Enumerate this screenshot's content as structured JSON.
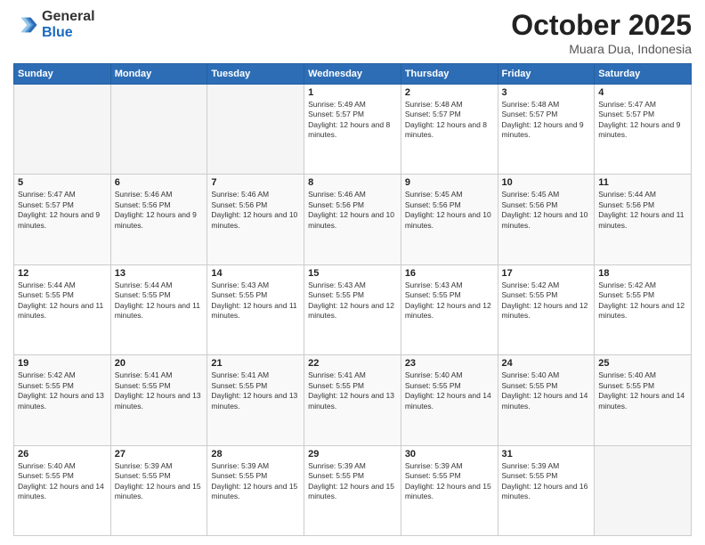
{
  "header": {
    "logo_general": "General",
    "logo_blue": "Blue",
    "month": "October 2025",
    "location": "Muara Dua, Indonesia"
  },
  "weekdays": [
    "Sunday",
    "Monday",
    "Tuesday",
    "Wednesday",
    "Thursday",
    "Friday",
    "Saturday"
  ],
  "weeks": [
    [
      {
        "day": "",
        "empty": true
      },
      {
        "day": "",
        "empty": true
      },
      {
        "day": "",
        "empty": true
      },
      {
        "day": "1",
        "sunrise": "5:49 AM",
        "sunset": "5:57 PM",
        "daylight": "12 hours and 8 minutes."
      },
      {
        "day": "2",
        "sunrise": "5:48 AM",
        "sunset": "5:57 PM",
        "daylight": "12 hours and 8 minutes."
      },
      {
        "day": "3",
        "sunrise": "5:48 AM",
        "sunset": "5:57 PM",
        "daylight": "12 hours and 9 minutes."
      },
      {
        "day": "4",
        "sunrise": "5:47 AM",
        "sunset": "5:57 PM",
        "daylight": "12 hours and 9 minutes."
      }
    ],
    [
      {
        "day": "5",
        "sunrise": "5:47 AM",
        "sunset": "5:57 PM",
        "daylight": "12 hours and 9 minutes."
      },
      {
        "day": "6",
        "sunrise": "5:46 AM",
        "sunset": "5:56 PM",
        "daylight": "12 hours and 9 minutes."
      },
      {
        "day": "7",
        "sunrise": "5:46 AM",
        "sunset": "5:56 PM",
        "daylight": "12 hours and 10 minutes."
      },
      {
        "day": "8",
        "sunrise": "5:46 AM",
        "sunset": "5:56 PM",
        "daylight": "12 hours and 10 minutes."
      },
      {
        "day": "9",
        "sunrise": "5:45 AM",
        "sunset": "5:56 PM",
        "daylight": "12 hours and 10 minutes."
      },
      {
        "day": "10",
        "sunrise": "5:45 AM",
        "sunset": "5:56 PM",
        "daylight": "12 hours and 10 minutes."
      },
      {
        "day": "11",
        "sunrise": "5:44 AM",
        "sunset": "5:56 PM",
        "daylight": "12 hours and 11 minutes."
      }
    ],
    [
      {
        "day": "12",
        "sunrise": "5:44 AM",
        "sunset": "5:55 PM",
        "daylight": "12 hours and 11 minutes."
      },
      {
        "day": "13",
        "sunrise": "5:44 AM",
        "sunset": "5:55 PM",
        "daylight": "12 hours and 11 minutes."
      },
      {
        "day": "14",
        "sunrise": "5:43 AM",
        "sunset": "5:55 PM",
        "daylight": "12 hours and 11 minutes."
      },
      {
        "day": "15",
        "sunrise": "5:43 AM",
        "sunset": "5:55 PM",
        "daylight": "12 hours and 12 minutes."
      },
      {
        "day": "16",
        "sunrise": "5:43 AM",
        "sunset": "5:55 PM",
        "daylight": "12 hours and 12 minutes."
      },
      {
        "day": "17",
        "sunrise": "5:42 AM",
        "sunset": "5:55 PM",
        "daylight": "12 hours and 12 minutes."
      },
      {
        "day": "18",
        "sunrise": "5:42 AM",
        "sunset": "5:55 PM",
        "daylight": "12 hours and 12 minutes."
      }
    ],
    [
      {
        "day": "19",
        "sunrise": "5:42 AM",
        "sunset": "5:55 PM",
        "daylight": "12 hours and 13 minutes."
      },
      {
        "day": "20",
        "sunrise": "5:41 AM",
        "sunset": "5:55 PM",
        "daylight": "12 hours and 13 minutes."
      },
      {
        "day": "21",
        "sunrise": "5:41 AM",
        "sunset": "5:55 PM",
        "daylight": "12 hours and 13 minutes."
      },
      {
        "day": "22",
        "sunrise": "5:41 AM",
        "sunset": "5:55 PM",
        "daylight": "12 hours and 13 minutes."
      },
      {
        "day": "23",
        "sunrise": "5:40 AM",
        "sunset": "5:55 PM",
        "daylight": "12 hours and 14 minutes."
      },
      {
        "day": "24",
        "sunrise": "5:40 AM",
        "sunset": "5:55 PM",
        "daylight": "12 hours and 14 minutes."
      },
      {
        "day": "25",
        "sunrise": "5:40 AM",
        "sunset": "5:55 PM",
        "daylight": "12 hours and 14 minutes."
      }
    ],
    [
      {
        "day": "26",
        "sunrise": "5:40 AM",
        "sunset": "5:55 PM",
        "daylight": "12 hours and 14 minutes."
      },
      {
        "day": "27",
        "sunrise": "5:39 AM",
        "sunset": "5:55 PM",
        "daylight": "12 hours and 15 minutes."
      },
      {
        "day": "28",
        "sunrise": "5:39 AM",
        "sunset": "5:55 PM",
        "daylight": "12 hours and 15 minutes."
      },
      {
        "day": "29",
        "sunrise": "5:39 AM",
        "sunset": "5:55 PM",
        "daylight": "12 hours and 15 minutes."
      },
      {
        "day": "30",
        "sunrise": "5:39 AM",
        "sunset": "5:55 PM",
        "daylight": "12 hours and 15 minutes."
      },
      {
        "day": "31",
        "sunrise": "5:39 AM",
        "sunset": "5:55 PM",
        "daylight": "12 hours and 16 minutes."
      },
      {
        "day": "",
        "empty": true
      }
    ]
  ]
}
